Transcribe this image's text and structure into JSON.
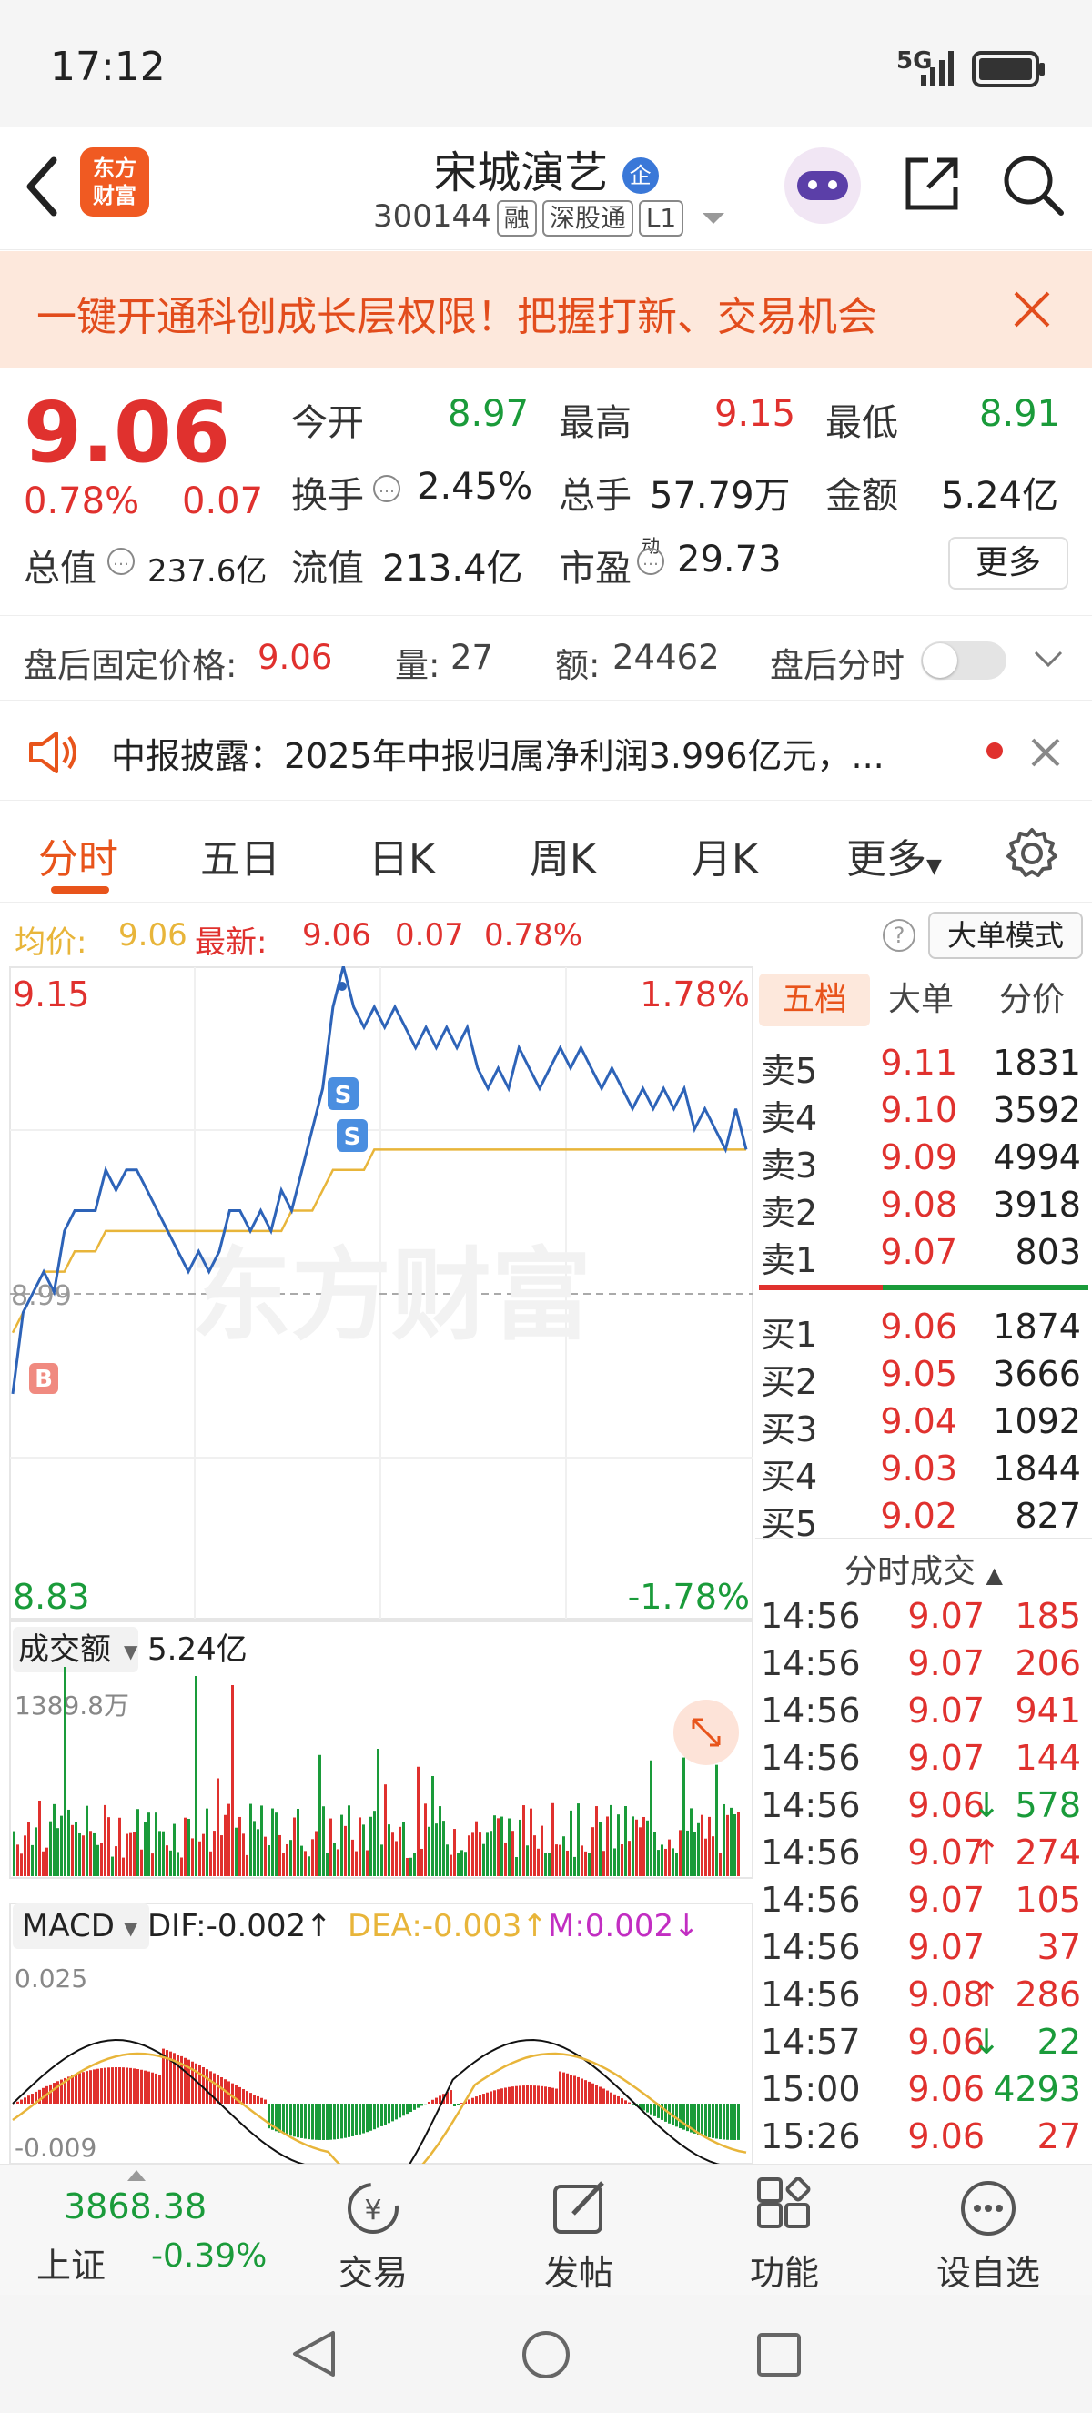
{
  "status_bar": {
    "time": "17:12",
    "network": "5G"
  },
  "header": {
    "stock_name": "宋城演艺",
    "enterprise_badge": "企",
    "app_logo_line1": "东方",
    "app_logo_line2": "财富",
    "stock_code": "300144",
    "tags": [
      "融",
      "深股通",
      "L1"
    ]
  },
  "banner": {
    "text": "一键开通科创成长层权限！把握打新、交易机会"
  },
  "quote": {
    "price": "9.06",
    "change_pct": "0.78%",
    "change": "0.07",
    "open_label": "今开",
    "open_value": "8.97",
    "high_label": "最高",
    "high_value": "9.15",
    "low_label": "最低",
    "low_value": "8.91",
    "turnover_label": "换手",
    "turnover_value": "2.45%",
    "volume_label": "总手",
    "volume_value": "57.79万",
    "amount_label": "金额",
    "amount_value": "5.24亿",
    "mktcap_label": "总值",
    "mktcap_value": "237.6亿",
    "float_label": "流值",
    "float_value": "213.4亿",
    "pe_label": "市盈",
    "pe_sup": "动",
    "pe_value": "29.73",
    "more_button": "更多"
  },
  "after_hours": {
    "price_label": "盘后固定价格:",
    "price_value": "9.06",
    "vol_label": "量:",
    "vol_value": "27",
    "amt_label": "额:",
    "amt_value": "24462",
    "toggle_label": "盘后分时"
  },
  "news": {
    "text": "中报披露：2025年中报归属净利润3.996亿元，..."
  },
  "tabs": [
    "分时",
    "五日",
    "日K",
    "周K",
    "月K",
    "更多"
  ],
  "avg_line": {
    "avg_label": "均价:",
    "avg_value": "9.06",
    "latest_label": "最新:",
    "latest_value": "9.06",
    "change": "0.07",
    "change_pct": "0.78%",
    "mode_button": "大单模式"
  },
  "chart": {
    "y_top": "9.15",
    "y_top_pct": "1.78%",
    "y_bottom": "8.83",
    "y_bottom_pct": "-1.78%",
    "mid_label": "8.99",
    "watermark": "东方财富",
    "marker_b": "B",
    "marker_s": "S",
    "volume_selector": "成交额",
    "volume_total": "5.24亿",
    "volume_max": "1389.8万",
    "macd_selector": "MACD",
    "dif": "DIF:-0.002↑",
    "dea": "DEA:-0.003↑",
    "m": "M:0.002↓",
    "macd_top": "0.025",
    "macd_bottom": "-0.009"
  },
  "chart_data": {
    "type": "line",
    "title": "",
    "ylim": [
      8.83,
      9.15
    ],
    "series": [
      {
        "name": "",
        "values": [
          8.94,
          8.98,
          8.99,
          9.0,
          8.99,
          9.02,
          9.03,
          9.03,
          9.03,
          9.05,
          9.04,
          9.05,
          9.05,
          9.04,
          9.03,
          9.02,
          9.01,
          9.0,
          9.01,
          9.0,
          9.01,
          9.03,
          9.03,
          9.02,
          9.03,
          9.02,
          9.04,
          9.03,
          9.05,
          9.07,
          9.09,
          9.13,
          9.15,
          9.13,
          9.12,
          9.13,
          9.12,
          9.13,
          9.12,
          9.11,
          9.12,
          9.11,
          9.12,
          9.11,
          9.12,
          9.1,
          9.09,
          9.1,
          9.09,
          9.11,
          9.1,
          9.09,
          9.1,
          9.11,
          9.1,
          9.11,
          9.1,
          9.09,
          9.1,
          9.09,
          9.08,
          9.09,
          9.08,
          9.09,
          9.08,
          9.09,
          9.07,
          9.08,
          9.07,
          9.06,
          9.08,
          9.06
        ]
      },
      {
        "name": "均价",
        "values": [
          8.97,
          8.98,
          8.99,
          9.0,
          9.0,
          9.0,
          9.01,
          9.01,
          9.01,
          9.02,
          9.02,
          9.02,
          9.02,
          9.02,
          9.02,
          9.02,
          9.02,
          9.02,
          9.02,
          9.02,
          9.02,
          9.02,
          9.02,
          9.02,
          9.02,
          9.02,
          9.02,
          9.03,
          9.03,
          9.03,
          9.04,
          9.05,
          9.05,
          9.05,
          9.05,
          9.06,
          9.06,
          9.06,
          9.06,
          9.06,
          9.06,
          9.06,
          9.06,
          9.06,
          9.06,
          9.06,
          9.06,
          9.06,
          9.06,
          9.06,
          9.06,
          9.06,
          9.06,
          9.06,
          9.06,
          9.06,
          9.06,
          9.06,
          9.06,
          9.06,
          9.06,
          9.06,
          9.06,
          9.06,
          9.06,
          9.06,
          9.06,
          9.06,
          9.06,
          9.06,
          9.06,
          9.06
        ]
      }
    ]
  },
  "book": {
    "tabs": [
      "五档",
      "大单",
      "分价"
    ],
    "asks": [
      {
        "label": "卖5",
        "price": "9.11",
        "vol": "1831"
      },
      {
        "label": "卖4",
        "price": "9.10",
        "vol": "3592"
      },
      {
        "label": "卖3",
        "price": "9.09",
        "vol": "4994"
      },
      {
        "label": "卖2",
        "price": "9.08",
        "vol": "3918"
      },
      {
        "label": "卖1",
        "price": "9.07",
        "vol": "803"
      }
    ],
    "bids": [
      {
        "label": "买1",
        "price": "9.06",
        "vol": "1874"
      },
      {
        "label": "买2",
        "price": "9.05",
        "vol": "3666"
      },
      {
        "label": "买3",
        "price": "9.04",
        "vol": "1092"
      },
      {
        "label": "买4",
        "price": "9.03",
        "vol": "1844"
      },
      {
        "label": "买5",
        "price": "9.02",
        "vol": "827"
      }
    ],
    "trades_title": "分时成交",
    "trades": [
      {
        "time": "14:56",
        "price": "9.07",
        "arrow": "",
        "vol": "185",
        "color": "red"
      },
      {
        "time": "14:56",
        "price": "9.07",
        "arrow": "",
        "vol": "206",
        "color": "red"
      },
      {
        "time": "14:56",
        "price": "9.07",
        "arrow": "",
        "vol": "941",
        "color": "red"
      },
      {
        "time": "14:56",
        "price": "9.07",
        "arrow": "",
        "vol": "144",
        "color": "red"
      },
      {
        "time": "14:56",
        "price": "9.06",
        "arrow": "↓",
        "vol": "578",
        "color": "green"
      },
      {
        "time": "14:56",
        "price": "9.07",
        "arrow": "↑",
        "vol": "274",
        "color": "red"
      },
      {
        "time": "14:56",
        "price": "9.07",
        "arrow": "",
        "vol": "105",
        "color": "red"
      },
      {
        "time": "14:56",
        "price": "9.07",
        "arrow": "",
        "vol": "37",
        "color": "red"
      },
      {
        "time": "14:56",
        "price": "9.08",
        "arrow": "↑",
        "vol": "286",
        "color": "red"
      },
      {
        "time": "14:57",
        "price": "9.06",
        "arrow": "↓",
        "vol": "22",
        "color": "green"
      },
      {
        "time": "15:00",
        "price": "9.06",
        "arrow": "",
        "vol": "4293",
        "color": "green"
      },
      {
        "time": "15:26",
        "price": "9.06",
        "arrow": "",
        "vol": "27",
        "color": "red"
      }
    ]
  },
  "bottom_bar": {
    "index_value": "3868.38",
    "index_name": "上证",
    "index_change": "-0.39%",
    "trade": "交易",
    "post": "发帖",
    "features": "功能",
    "watchlist": "设自选"
  },
  "colors": {
    "up": "#e0312e",
    "down": "#1a9b3a",
    "accent": "#e8541b",
    "price_line": "#2d63b8",
    "avg_line": "#e8b53a"
  }
}
